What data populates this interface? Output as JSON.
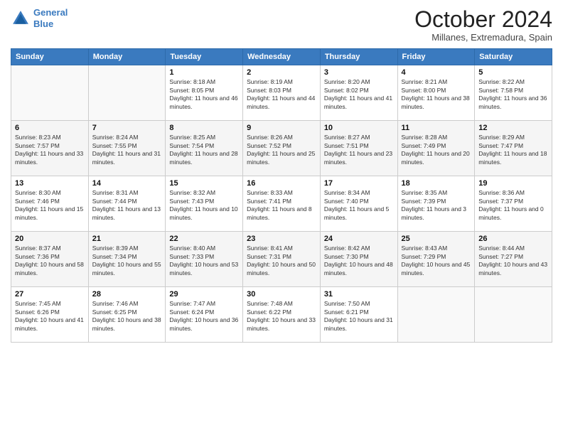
{
  "header": {
    "logo_line1": "General",
    "logo_line2": "Blue",
    "month": "October 2024",
    "location": "Millanes, Extremadura, Spain"
  },
  "days_of_week": [
    "Sunday",
    "Monday",
    "Tuesday",
    "Wednesday",
    "Thursday",
    "Friday",
    "Saturday"
  ],
  "weeks": [
    [
      {
        "day": "",
        "info": ""
      },
      {
        "day": "",
        "info": ""
      },
      {
        "day": "1",
        "info": "Sunrise: 8:18 AM\nSunset: 8:05 PM\nDaylight: 11 hours and 46 minutes."
      },
      {
        "day": "2",
        "info": "Sunrise: 8:19 AM\nSunset: 8:03 PM\nDaylight: 11 hours and 44 minutes."
      },
      {
        "day": "3",
        "info": "Sunrise: 8:20 AM\nSunset: 8:02 PM\nDaylight: 11 hours and 41 minutes."
      },
      {
        "day": "4",
        "info": "Sunrise: 8:21 AM\nSunset: 8:00 PM\nDaylight: 11 hours and 38 minutes."
      },
      {
        "day": "5",
        "info": "Sunrise: 8:22 AM\nSunset: 7:58 PM\nDaylight: 11 hours and 36 minutes."
      }
    ],
    [
      {
        "day": "6",
        "info": "Sunrise: 8:23 AM\nSunset: 7:57 PM\nDaylight: 11 hours and 33 minutes."
      },
      {
        "day": "7",
        "info": "Sunrise: 8:24 AM\nSunset: 7:55 PM\nDaylight: 11 hours and 31 minutes."
      },
      {
        "day": "8",
        "info": "Sunrise: 8:25 AM\nSunset: 7:54 PM\nDaylight: 11 hours and 28 minutes."
      },
      {
        "day": "9",
        "info": "Sunrise: 8:26 AM\nSunset: 7:52 PM\nDaylight: 11 hours and 25 minutes."
      },
      {
        "day": "10",
        "info": "Sunrise: 8:27 AM\nSunset: 7:51 PM\nDaylight: 11 hours and 23 minutes."
      },
      {
        "day": "11",
        "info": "Sunrise: 8:28 AM\nSunset: 7:49 PM\nDaylight: 11 hours and 20 minutes."
      },
      {
        "day": "12",
        "info": "Sunrise: 8:29 AM\nSunset: 7:47 PM\nDaylight: 11 hours and 18 minutes."
      }
    ],
    [
      {
        "day": "13",
        "info": "Sunrise: 8:30 AM\nSunset: 7:46 PM\nDaylight: 11 hours and 15 minutes."
      },
      {
        "day": "14",
        "info": "Sunrise: 8:31 AM\nSunset: 7:44 PM\nDaylight: 11 hours and 13 minutes."
      },
      {
        "day": "15",
        "info": "Sunrise: 8:32 AM\nSunset: 7:43 PM\nDaylight: 11 hours and 10 minutes."
      },
      {
        "day": "16",
        "info": "Sunrise: 8:33 AM\nSunset: 7:41 PM\nDaylight: 11 hours and 8 minutes."
      },
      {
        "day": "17",
        "info": "Sunrise: 8:34 AM\nSunset: 7:40 PM\nDaylight: 11 hours and 5 minutes."
      },
      {
        "day": "18",
        "info": "Sunrise: 8:35 AM\nSunset: 7:39 PM\nDaylight: 11 hours and 3 minutes."
      },
      {
        "day": "19",
        "info": "Sunrise: 8:36 AM\nSunset: 7:37 PM\nDaylight: 11 hours and 0 minutes."
      }
    ],
    [
      {
        "day": "20",
        "info": "Sunrise: 8:37 AM\nSunset: 7:36 PM\nDaylight: 10 hours and 58 minutes."
      },
      {
        "day": "21",
        "info": "Sunrise: 8:39 AM\nSunset: 7:34 PM\nDaylight: 10 hours and 55 minutes."
      },
      {
        "day": "22",
        "info": "Sunrise: 8:40 AM\nSunset: 7:33 PM\nDaylight: 10 hours and 53 minutes."
      },
      {
        "day": "23",
        "info": "Sunrise: 8:41 AM\nSunset: 7:31 PM\nDaylight: 10 hours and 50 minutes."
      },
      {
        "day": "24",
        "info": "Sunrise: 8:42 AM\nSunset: 7:30 PM\nDaylight: 10 hours and 48 minutes."
      },
      {
        "day": "25",
        "info": "Sunrise: 8:43 AM\nSunset: 7:29 PM\nDaylight: 10 hours and 45 minutes."
      },
      {
        "day": "26",
        "info": "Sunrise: 8:44 AM\nSunset: 7:27 PM\nDaylight: 10 hours and 43 minutes."
      }
    ],
    [
      {
        "day": "27",
        "info": "Sunrise: 7:45 AM\nSunset: 6:26 PM\nDaylight: 10 hours and 41 minutes."
      },
      {
        "day": "28",
        "info": "Sunrise: 7:46 AM\nSunset: 6:25 PM\nDaylight: 10 hours and 38 minutes."
      },
      {
        "day": "29",
        "info": "Sunrise: 7:47 AM\nSunset: 6:24 PM\nDaylight: 10 hours and 36 minutes."
      },
      {
        "day": "30",
        "info": "Sunrise: 7:48 AM\nSunset: 6:22 PM\nDaylight: 10 hours and 33 minutes."
      },
      {
        "day": "31",
        "info": "Sunrise: 7:50 AM\nSunset: 6:21 PM\nDaylight: 10 hours and 31 minutes."
      },
      {
        "day": "",
        "info": ""
      },
      {
        "day": "",
        "info": ""
      }
    ]
  ]
}
